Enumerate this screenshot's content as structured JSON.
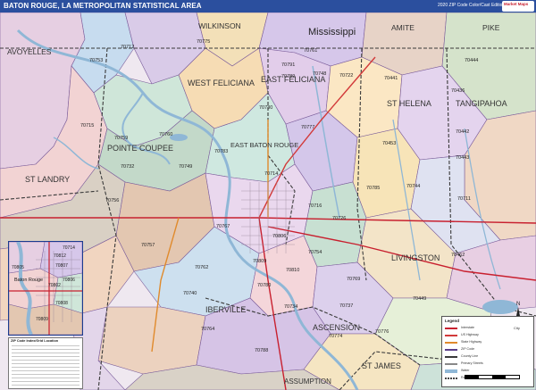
{
  "title_bar": {
    "title": "BATON ROUGE, LA METROPOLITAN STATISTICAL AREA",
    "edition": "2020 ZIP Code Color/Cast Edition",
    "logo_text": "Market Maps"
  },
  "colors": {
    "title_bar": "#2b4f9e",
    "water": "#8fb7d6",
    "county_line": "#3a3a3a",
    "zip_line": "#5a3f8a",
    "highway": "#d23a3a"
  },
  "region_labels": [
    {
      "text": "Mississippi",
      "size": "large"
    },
    {
      "text": "WILKINSON",
      "size": "county"
    },
    {
      "text": "AMITE",
      "size": "county"
    },
    {
      "text": "PIKE",
      "size": "county"
    },
    {
      "text": "AVOYELLES",
      "size": "county"
    },
    {
      "text": "WEST FELICIANA",
      "size": "county"
    },
    {
      "text": "EAST FELICIANA",
      "size": "county"
    },
    {
      "text": "ST HELENA",
      "size": "county"
    },
    {
      "text": "TANGIPAHOA",
      "size": "county"
    },
    {
      "text": "POINTE COUPEE",
      "size": "county"
    },
    {
      "text": "EAST BATON ROUGE",
      "size": "county"
    },
    {
      "text": "ST LANDRY",
      "size": "county"
    },
    {
      "text": "LIVINGSTON",
      "size": "county"
    },
    {
      "text": "IBERVILLE",
      "size": "county"
    },
    {
      "text": "ASCENSION",
      "size": "county"
    },
    {
      "text": "ST JAMES",
      "size": "county"
    },
    {
      "text": "ASSUMPTION",
      "size": "county"
    }
  ],
  "zip_labels": [
    "70712",
    "70775",
    "70761",
    "70753",
    "70791",
    "70748",
    "70722",
    "70789",
    "70441",
    "70444",
    "70715",
    "70730",
    "70777",
    "70436",
    "70442",
    "70443",
    "70759",
    "70760",
    "70783",
    "70714",
    "70453",
    "70711",
    "70732",
    "70749",
    "70756",
    "70757",
    "70785",
    "70744",
    "70462",
    "70767",
    "70806",
    "70754",
    "70726",
    "70716",
    "70762",
    "70809",
    "70740",
    "70780",
    "70810",
    "70769",
    "70449",
    "70764",
    "70788",
    "70737",
    "70774",
    "70776",
    "70734"
  ],
  "inset": {
    "labels": [
      "70812",
      "70805",
      "70807",
      "70802",
      "70808",
      "70809",
      "70714",
      "70806"
    ],
    "water_label": "Baton Rouge"
  },
  "index": {
    "title": "ZIP Code Index/Grid Location"
  },
  "legend": {
    "title": "Legend",
    "items": [
      {
        "label": "Interstate",
        "color": "#c8202f"
      },
      {
        "label": "US Highway",
        "color": "#d23a3a"
      },
      {
        "label": "State Highway",
        "color": "#e08a2c"
      },
      {
        "label": "ZIP Code",
        "color": "#5a3f8a"
      },
      {
        "label": "County Line",
        "color": "#3a3a3a"
      },
      {
        "label": "Primary Streets",
        "color": "#888888"
      },
      {
        "label": "Water",
        "color": "#8fb7d6"
      },
      {
        "label": "Railroad",
        "color": "#444444"
      }
    ]
  },
  "compass_label": "N",
  "city_legend_label": "City"
}
